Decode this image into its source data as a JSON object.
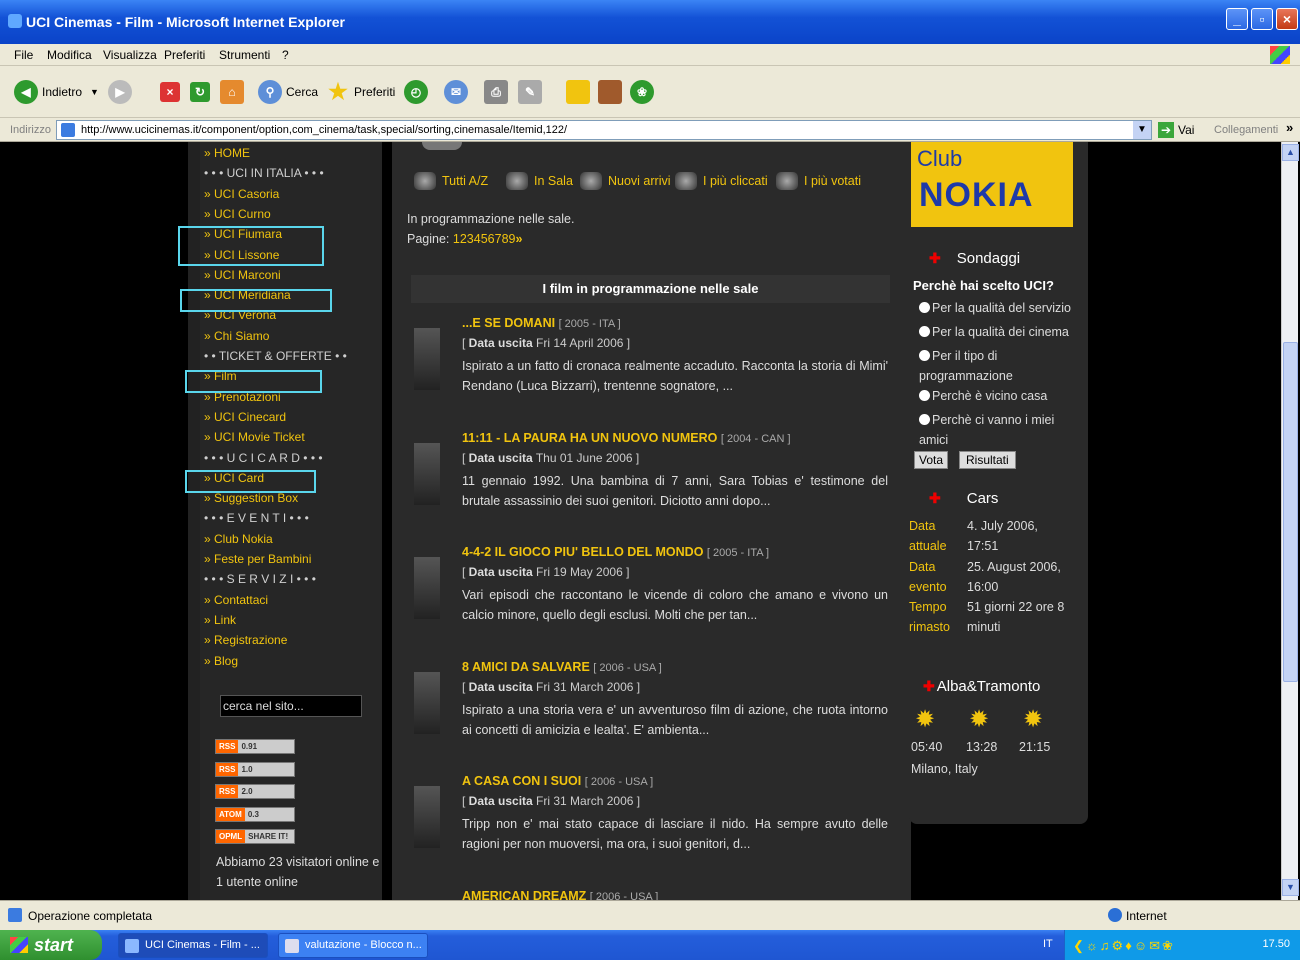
{
  "window": {
    "title": "UCI Cinemas - Film - Microsoft Internet Explorer"
  },
  "menu": [
    "File",
    "Modifica",
    "Visualizza",
    "Preferiti",
    "Strumenti",
    "?"
  ],
  "toolbar": {
    "back": "Indietro",
    "search": "Cerca",
    "favorites": "Preferiti"
  },
  "address": {
    "label": "Indirizzo",
    "url": "http://www.ucicinemas.it/component/option,com_cinema/task,special/sorting,cinemasale/Itemid,122/",
    "go": "Vai",
    "links": "Collegamenti"
  },
  "nav": [
    {
      "text": "» HOME",
      "sec": false
    },
    {
      "text": "• • • UCI IN ITALIA • • •",
      "sec": true
    },
    {
      "text": "» UCI Casoria",
      "sec": false
    },
    {
      "text": "» UCI Curno",
      "sec": false
    },
    {
      "text": "» UCI Fiumara",
      "sec": false
    },
    {
      "text": "» UCI Lissone",
      "sec": false
    },
    {
      "text": "» UCI Marconi",
      "sec": false
    },
    {
      "text": "» UCI Meridiana",
      "sec": false
    },
    {
      "text": "» UCI Verona",
      "sec": false
    },
    {
      "text": "» Chi Siamo",
      "sec": false
    },
    {
      "text": "• • TICKET & OFFERTE • •",
      "sec": true
    },
    {
      "text": "» Film",
      "sec": false
    },
    {
      "text": "» Prenotazioni",
      "sec": false
    },
    {
      "text": "» UCI Cinecard",
      "sec": false
    },
    {
      "text": "» UCI Movie Ticket",
      "sec": false
    },
    {
      "text": "• • • U C I C A R D • • •",
      "sec": true
    },
    {
      "text": "» UCI Card",
      "sec": false
    },
    {
      "text": "» Suggestion Box",
      "sec": false
    },
    {
      "text": "• • • E V E N T I • • •",
      "sec": true
    },
    {
      "text": "» Club Nokia",
      "sec": false
    },
    {
      "text": "» Feste per Bambini",
      "sec": false
    },
    {
      "text": "• • • S E R V I Z I • • •",
      "sec": true
    },
    {
      "text": "» Contattaci",
      "sec": false
    },
    {
      "text": "» Link",
      "sec": false
    },
    {
      "text": "» Registrazione",
      "sec": false
    },
    {
      "text": "» Blog",
      "sec": false
    }
  ],
  "search": {
    "value": "cerca nel sito..."
  },
  "feeds": [
    {
      "a": "RSS",
      "b": "0.91"
    },
    {
      "a": "RSS",
      "b": "1.0"
    },
    {
      "a": "RSS",
      "b": "2.0"
    },
    {
      "a": "ATOM",
      "b": "0.3"
    },
    {
      "a": "OPML",
      "b": "SHARE IT!"
    }
  ],
  "visitors": "Abbiamo 23 visitatori online e 1 utente online",
  "filters": [
    "Tutti A/Z",
    "In Sala",
    "Nuovi arrivi",
    "I più cliccati",
    "I più votati"
  ],
  "intro": "In programmazione nelle sale.",
  "pages_label": "Pagine:",
  "pages": [
    "1",
    "2",
    "3",
    "4",
    "5",
    "6",
    "7",
    "8",
    "9",
    "»"
  ],
  "section_title": "I film in programmazione nelle sale",
  "release_label": "Data uscita",
  "films": [
    {
      "title": "...E SE DOMANI",
      "meta": "[ 2005 - ITA ]",
      "date": "Fri 14 April 2006",
      "syn": "Ispirato a un fatto di cronaca realmente accaduto. Racconta la storia di Mimi' Rendano (Luca Bizzarri), trentenne sognatore, ..."
    },
    {
      "title": "11:11 - LA PAURA HA UN NUOVO NUMERO",
      "meta": "[ 2004 - CAN ]",
      "date": "Thu 01 June 2006",
      "syn": "11 gennaio 1992. Una bambina di 7 anni, Sara Tobias e' testimone del brutale assassinio dei suoi genitori. Diciotto anni dopo..."
    },
    {
      "title": "4-4-2 IL GIOCO PIU' BELLO DEL MONDO",
      "meta": "[ 2005 - ITA ]",
      "date": "Fri 19 May 2006",
      "syn": "Vari episodi che raccontano le vicende di coloro che amano e vivono un calcio minore, quello degli esclusi. Molti che per tan..."
    },
    {
      "title": "8 AMICI DA SALVARE",
      "meta": "[ 2006 - USA ]",
      "date": "Fri 31 March 2006",
      "syn": "Ispirato a una storia vera e' un avventuroso film di azione, che ruota intorno ai concetti di amicizia e lealta'. E' ambienta..."
    },
    {
      "title": "A CASA CON I SUOI",
      "meta": "[ 2006 - USA ]",
      "date": "Fri 31 March 2006",
      "syn": "Tripp non e' mai stato capace di lasciare il nido. Ha sempre avuto delle ragioni per non muoversi, ma ora, i suoi genitori, d..."
    },
    {
      "title": "AMERICAN DREAMZ",
      "meta": "[ 2006 - USA ]",
      "date": "",
      "syn": ""
    }
  ],
  "club": {
    "c": "Club",
    "n": "NOKIA"
  },
  "poll": {
    "title": "Sondaggi",
    "q": "Perchè hai scelto UCI?",
    "options": [
      "Per la qualità del servizio",
      "Per la qualità dei cinema",
      "Per il tipo di programmazione",
      "Perchè è vicino casa",
      "Perchè ci vanno i miei amici"
    ],
    "vote": "Vota",
    "results": "Risultati"
  },
  "cars": {
    "title": "Cars",
    "rows": [
      {
        "k": "Data attuale",
        "v": "4. July 2006, 17:51"
      },
      {
        "k": "Data evento",
        "v": "25. August 2006, 16:00"
      },
      {
        "k": "Tempo rimasto",
        "v": "51 giorni 22 ore 8 minuti"
      }
    ]
  },
  "sun": {
    "title": "Alba&Tramonto",
    "times": [
      "05:40",
      "13:28",
      "21:15"
    ],
    "loc": "Milano, Italy"
  },
  "status": {
    "text": "Operazione completata",
    "zone": "Internet"
  },
  "taskbar": {
    "start": "start",
    "tasks": [
      "UCI Cinemas - Film - ...",
      "valutazione - Blocco n..."
    ],
    "lang": "IT",
    "clock": "17.50"
  }
}
